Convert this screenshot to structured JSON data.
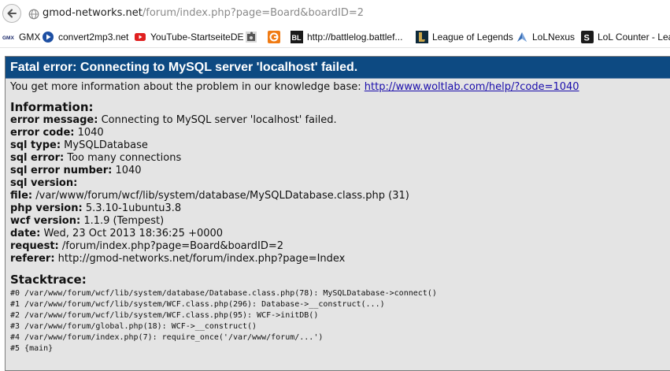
{
  "browser": {
    "url_host": "gmod-networks.net",
    "url_path": "/forum/index.php?page=Board&boardID=2",
    "icons": {
      "back": "back-arrow-icon",
      "page": "globe-icon"
    }
  },
  "bookmarks": [
    {
      "label": "GMX",
      "icon": "gmx-logo-icon"
    },
    {
      "label": "convert2mp3.net",
      "icon": "play-circle-icon"
    },
    {
      "label": "YouTube-StartseiteDE",
      "icon": "youtube-icon"
    },
    {
      "label": "",
      "icon": "puzzle-icon"
    },
    {
      "label": "",
      "icon": "orange-circle-icon"
    },
    {
      "label": "http://battlelog.battlef...",
      "icon": "battlelog-icon"
    },
    {
      "label": "League of Legends",
      "icon": "league-of-legends-icon"
    },
    {
      "label": "LoLNexus",
      "icon": "lolnexus-icon"
    },
    {
      "label": "LoL Counter - Lea",
      "icon": "lolcounter-icon"
    }
  ],
  "error": {
    "title": "Fatal error: Connecting to MySQL server 'localhost' failed.",
    "intro_text": "You get more information about the problem in our knowledge base: ",
    "intro_link": "http://www.woltlab.com/help/?code=1040",
    "information_heading": "Information:",
    "info": [
      {
        "label": "error message:",
        "value": " Connecting to MySQL server 'localhost' failed."
      },
      {
        "label": "error code:",
        "value": " 1040"
      },
      {
        "label": "sql type:",
        "value": " MySQLDatabase"
      },
      {
        "label": "sql error:",
        "value": " Too many connections"
      },
      {
        "label": "sql error number:",
        "value": " 1040"
      },
      {
        "label": "sql version:",
        "value": ""
      },
      {
        "label": "file:",
        "value": " /var/www/forum/wcf/lib/system/database/MySQLDatabase.class.php (31)"
      },
      {
        "label": "php version:",
        "value": " 5.3.10-1ubuntu3.8"
      },
      {
        "label": "wcf version:",
        "value": " 1.1.9 (Tempest)"
      },
      {
        "label": "date:",
        "value": " Wed, 23 Oct 2013 18:36:25 +0000"
      },
      {
        "label": "request:",
        "value": " /forum/index.php?page=Board&boardID=2"
      },
      {
        "label": "referer:",
        "value": " http://gmod-networks.net/forum/index.php?page=Index"
      }
    ],
    "stacktrace_heading": "Stacktrace:",
    "stacktrace": [
      "#0 /var/www/forum/wcf/lib/system/database/Database.class.php(78): MySQLDatabase->connect()",
      "#1 /var/www/forum/wcf/lib/system/WCF.class.php(296): Database->__construct(...)",
      "#2 /var/www/forum/wcf/lib/system/WCF.class.php(95): WCF->initDB()",
      "#3 /var/www/forum/global.php(18): WCF->__construct()",
      "#4 /var/www/forum/index.php(7): require_once('/var/www/forum/...')",
      "#5 {main}"
    ]
  },
  "colors": {
    "title_bar": "#0d4a82",
    "box_background": "#e4e4e4",
    "link": "#1a0dab"
  }
}
